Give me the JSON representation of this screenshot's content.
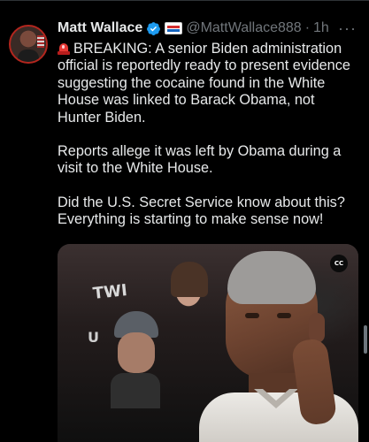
{
  "tweet": {
    "author_name": "Matt Wallace",
    "handle": "@MattWallace888",
    "separator": "·",
    "time": "1h",
    "more_label": "···",
    "body": {
      "paragraph_1": "BREAKING: A senior Biden administration official is reportedly ready to present evidence suggesting the cocaine found in the White House was linked to Barack Obama, not Hunter Biden.",
      "paragraph_2": "Reports allege it was left by Obama during a visit to the White House.",
      "paragraph_3": "Did the U.S. Secret Service know about this? Everything is starting to make sense now!"
    },
    "media": {
      "caption_badge": "CC",
      "sign_text_1": "TWI",
      "sign_text_2": "U"
    }
  },
  "icons": {
    "verified": "verified-badge-icon",
    "affiliate": "affiliate-badge-icon",
    "siren": "siren-icon",
    "more": "more-icon"
  },
  "colors": {
    "background": "#000000",
    "text": "#e7e9ea",
    "muted": "#71767b",
    "verified_blue": "#1d9bf0",
    "siren_red": "#e53935"
  }
}
